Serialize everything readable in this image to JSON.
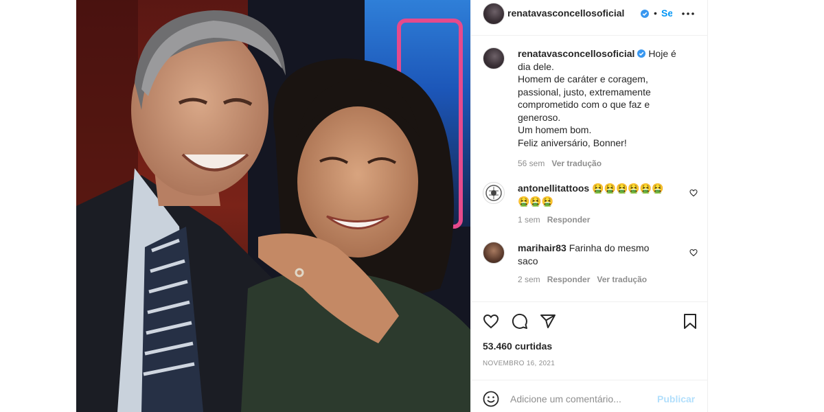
{
  "post": {
    "username": "renatavasconcellosoficial",
    "follow_label": "Seguir",
    "caption_lines": [
      "Hoje é",
      "dia dele.",
      "Homem de caráter e coragem,",
      "passional, justo, extremamente",
      "comprometido com o que faz e",
      "generoso.",
      "Um homem bom.",
      "Feliz aniversário, Bonner!"
    ],
    "caption_time": "56 sem",
    "caption_translate": "Ver tradução"
  },
  "comments": [
    {
      "username": "antonellitattoos",
      "text_line1": "🤮🤮🤮🤮🤮🤮",
      "text_line2": "🤮🤮🤮",
      "time": "1 sem",
      "reply": "Responder"
    },
    {
      "username": "marihair83",
      "text_line1": "Farinha do mesmo",
      "text_line2": "saco",
      "time": "2 sem",
      "reply": "Responder",
      "translate": "Ver tradução"
    }
  ],
  "stats": {
    "likes": "53.460 curtidas",
    "date": "NOVEMBRO 16, 2021"
  },
  "composer": {
    "placeholder": "Adicione um comentário...",
    "publish": "Publicar"
  },
  "icons": [
    "more-options-icon",
    "verified-badge-icon",
    "like-icon",
    "comment-icon",
    "share-icon",
    "save-icon",
    "emoji-icon",
    "heart-icon"
  ],
  "colors": {
    "accent": "#0095f6",
    "verified": "#3897f0",
    "muted": "#8e8e8e",
    "text": "#262626"
  }
}
